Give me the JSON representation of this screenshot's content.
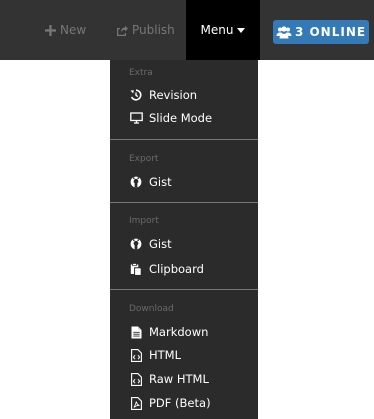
{
  "navbar": {
    "new_label": "New",
    "publish_label": "Publish",
    "menu_label": "Menu",
    "online_label": "3 ONLINE"
  },
  "menu": {
    "extra": {
      "header": "Extra",
      "items": [
        "Revision",
        "Slide Mode"
      ]
    },
    "export": {
      "header": "Export",
      "items": [
        "Gist"
      ]
    },
    "import": {
      "header": "Import",
      "items": [
        "Gist",
        "Clipboard"
      ]
    },
    "download": {
      "header": "Download",
      "items": [
        "Markdown",
        "HTML",
        "Raw HTML",
        "PDF (Beta)"
      ]
    }
  },
  "colors": {
    "navbar_bg": "#333333",
    "menu_bg": "#2b2b2b",
    "active_bg": "#000000",
    "badge_blue": "#337ab7"
  }
}
